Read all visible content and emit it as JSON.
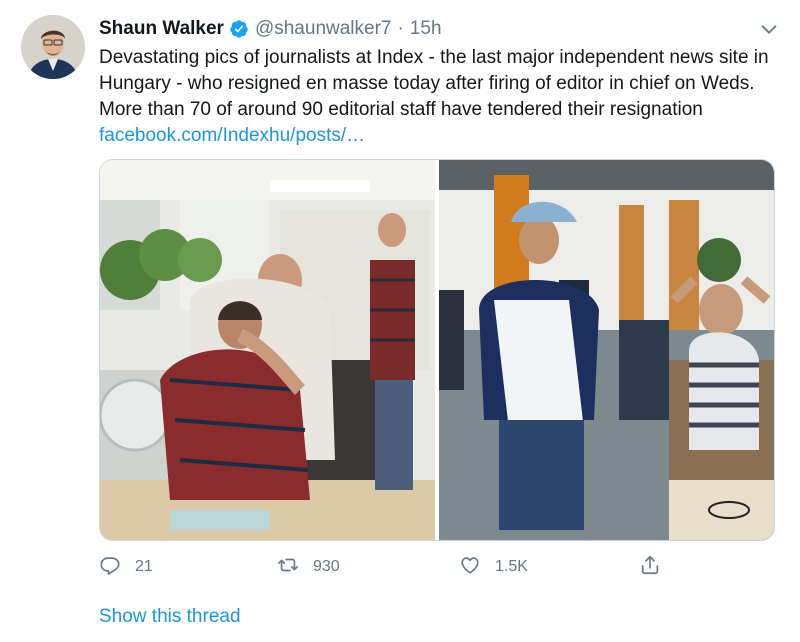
{
  "tweet": {
    "author_name": "Shaun Walker",
    "handle": "@shaunwalker7",
    "separator": "·",
    "time": "15h",
    "text": "Devastating pics of journalists at Index - the last major independent news site in Hungary - who resigned en masse today after firing of editor in chief on Weds. More than 70 of around 90 editorial staff have tendered their resignation",
    "link": "facebook.com/Indexhu/posts/…",
    "icons": {
      "verified": "verified-badge-icon",
      "more": "chevron-down-icon"
    },
    "accent_color": "#1b95e0"
  },
  "actions": {
    "reply_count": "21",
    "retweet_count": "930",
    "like_count": "1.5K",
    "icons": [
      "reply-icon",
      "retweet-icon",
      "like-icon",
      "share-icon"
    ]
  },
  "show_thread": "Show this thread"
}
